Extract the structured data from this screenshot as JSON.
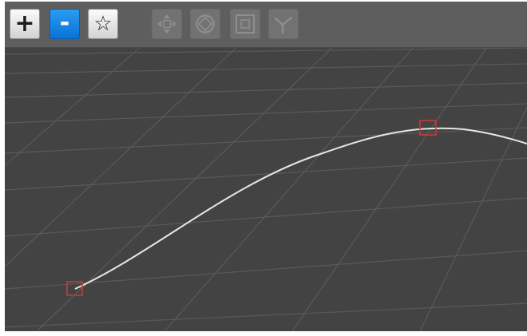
{
  "toolbar": {
    "buttons": [
      {
        "name": "add-point-button",
        "glyph": "+",
        "icon": "plus-icon",
        "state": "normal"
      },
      {
        "name": "remove-point-button",
        "glyph": "-",
        "icon": "minus-icon",
        "state": "active"
      },
      {
        "name": "star-point-button",
        "glyph": "☆",
        "icon": "star-icon",
        "state": "normal"
      }
    ],
    "tools": [
      {
        "name": "move-tool-button",
        "icon": "move-arrows-icon",
        "state": "disabled"
      },
      {
        "name": "rotate-tool-button",
        "icon": "rotate-icon",
        "state": "disabled"
      },
      {
        "name": "scale-tool-button",
        "icon": "scale-box-icon",
        "state": "disabled"
      },
      {
        "name": "tangent-tool-button",
        "icon": "tangent-branch-icon",
        "state": "disabled"
      }
    ]
  },
  "scene": {
    "background": "#434343",
    "toolbar_background": "#5e5e5e",
    "grid_color": "#5a5a5a",
    "spline_color": "#e6e6e6",
    "handle_color": "#c63a3a",
    "active_color": "#1583e6"
  }
}
